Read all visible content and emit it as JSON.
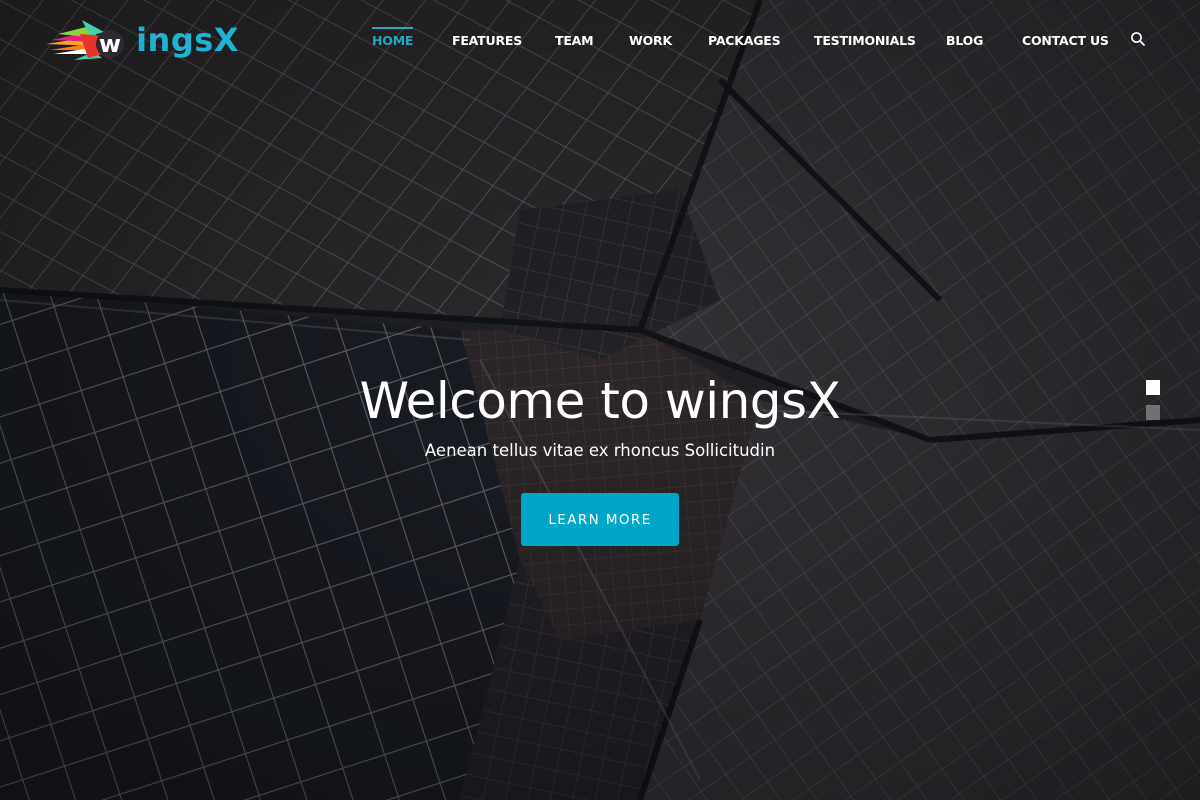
{
  "brand": {
    "name_prefix": "w",
    "name_rest": "ingsX",
    "accent_color": "#1fb3d3"
  },
  "nav": {
    "items": [
      {
        "label": "HOME",
        "active": true
      },
      {
        "label": "FEATURES",
        "active": false
      },
      {
        "label": "TEAM",
        "active": false
      },
      {
        "label": "WORK",
        "active": false
      },
      {
        "label": "PACKAGES",
        "active": false
      },
      {
        "label": "TESTIMONIALS",
        "active": false
      },
      {
        "label": "BLOG",
        "active": false
      },
      {
        "label": "CONTACT US",
        "active": false
      }
    ],
    "search_icon": "search-icon",
    "active_color": "#1fa9c4"
  },
  "hero": {
    "title": "Welcome to wingsX",
    "subtitle": "Aenean tellus vitae ex rhoncus Sollicitudin",
    "cta_label": "LEARN MORE",
    "cta_color": "#00a6c9",
    "slides": {
      "count": 2,
      "active_index": 0
    }
  }
}
